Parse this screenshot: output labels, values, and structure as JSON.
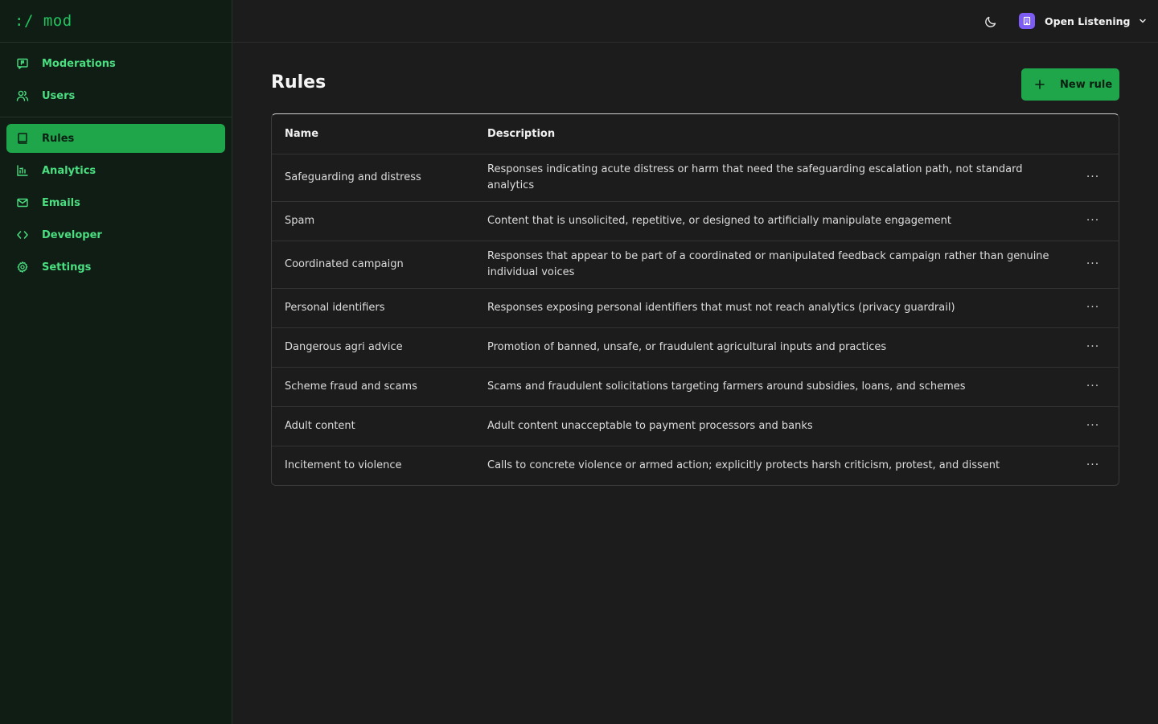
{
  "app": {
    "logo": ":/ mod"
  },
  "sidebar": {
    "primary": [
      {
        "label": "Moderations",
        "icon": "message-flag-icon"
      },
      {
        "label": "Users",
        "icon": "users-icon"
      }
    ],
    "secondary": [
      {
        "label": "Rules",
        "icon": "book-icon",
        "active": true
      },
      {
        "label": "Analytics",
        "icon": "chart-icon"
      },
      {
        "label": "Emails",
        "icon": "mail-icon"
      },
      {
        "label": "Developer",
        "icon": "code-icon"
      },
      {
        "label": "Settings",
        "icon": "gear-icon"
      }
    ]
  },
  "topbar": {
    "org_name": "Open Listening",
    "theme_icon": "moon-icon"
  },
  "page": {
    "title": "Rules",
    "new_button_label": "New rule"
  },
  "table": {
    "columns": [
      "Name",
      "Description"
    ],
    "rows": [
      {
        "name": "Safeguarding and distress",
        "description": "Responses indicating acute distress or harm that need the safeguarding escalation path, not standard analytics"
      },
      {
        "name": "Spam",
        "description": "Content that is unsolicited, repetitive, or designed to artificially manipulate engagement"
      },
      {
        "name": "Coordinated campaign",
        "description": "Responses that appear to be part of a coordinated or manipulated feedback campaign rather than genuine individual voices"
      },
      {
        "name": "Personal identifiers",
        "description": "Responses exposing personal identifiers that must not reach analytics (privacy guardrail)"
      },
      {
        "name": "Dangerous agri advice",
        "description": "Promotion of banned, unsafe, or fraudulent agricultural inputs and practices"
      },
      {
        "name": "Scheme fraud and scams",
        "description": "Scams and fraudulent solicitations targeting farmers around subsidies, loans, and schemes"
      },
      {
        "name": "Adult content",
        "description": "Adult content unacceptable to payment processors and banks"
      },
      {
        "name": "Incitement to violence",
        "description": "Calls to concrete violence or armed action; explicitly protects harsh criticism, protest, and dissent"
      }
    ],
    "row_action_icon": "more-horizontal-icon"
  },
  "colors": {
    "accent": "#1fa54a",
    "accent_text": "#4ade80",
    "sidebar_bg": "#0f1d15",
    "main_bg": "#1c1c1c",
    "org_avatar": "#7c5cf5"
  }
}
